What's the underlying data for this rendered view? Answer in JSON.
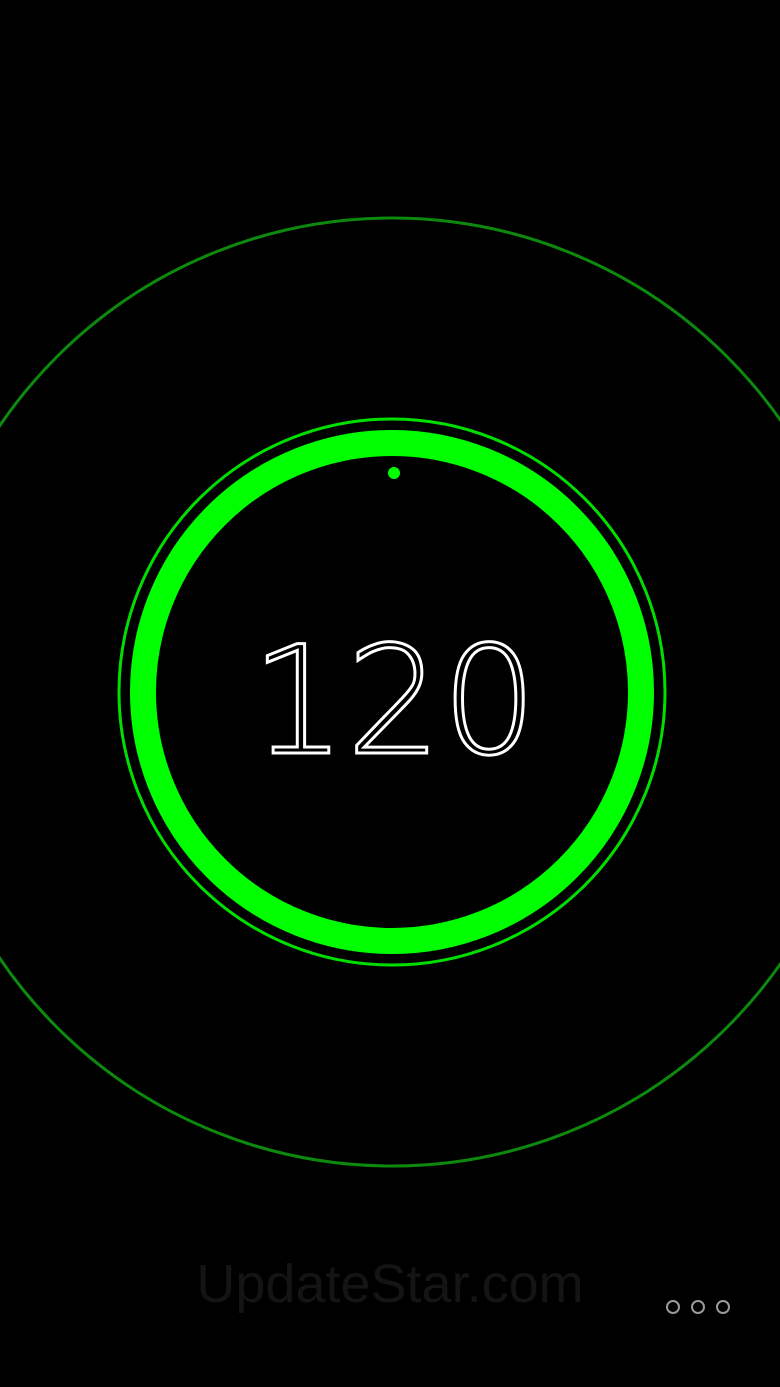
{
  "display": {
    "value": "120"
  },
  "watermark": {
    "text": "UpdateStar.com"
  },
  "colors": {
    "background": "#000000",
    "accent": "#00ff00",
    "outer_ring": "#0d8a0d",
    "text": "#ffffff",
    "more_dots": "#9a9a9a"
  },
  "icons": {
    "more": "more-dots-icon",
    "indicator": "beat-indicator-dot"
  }
}
